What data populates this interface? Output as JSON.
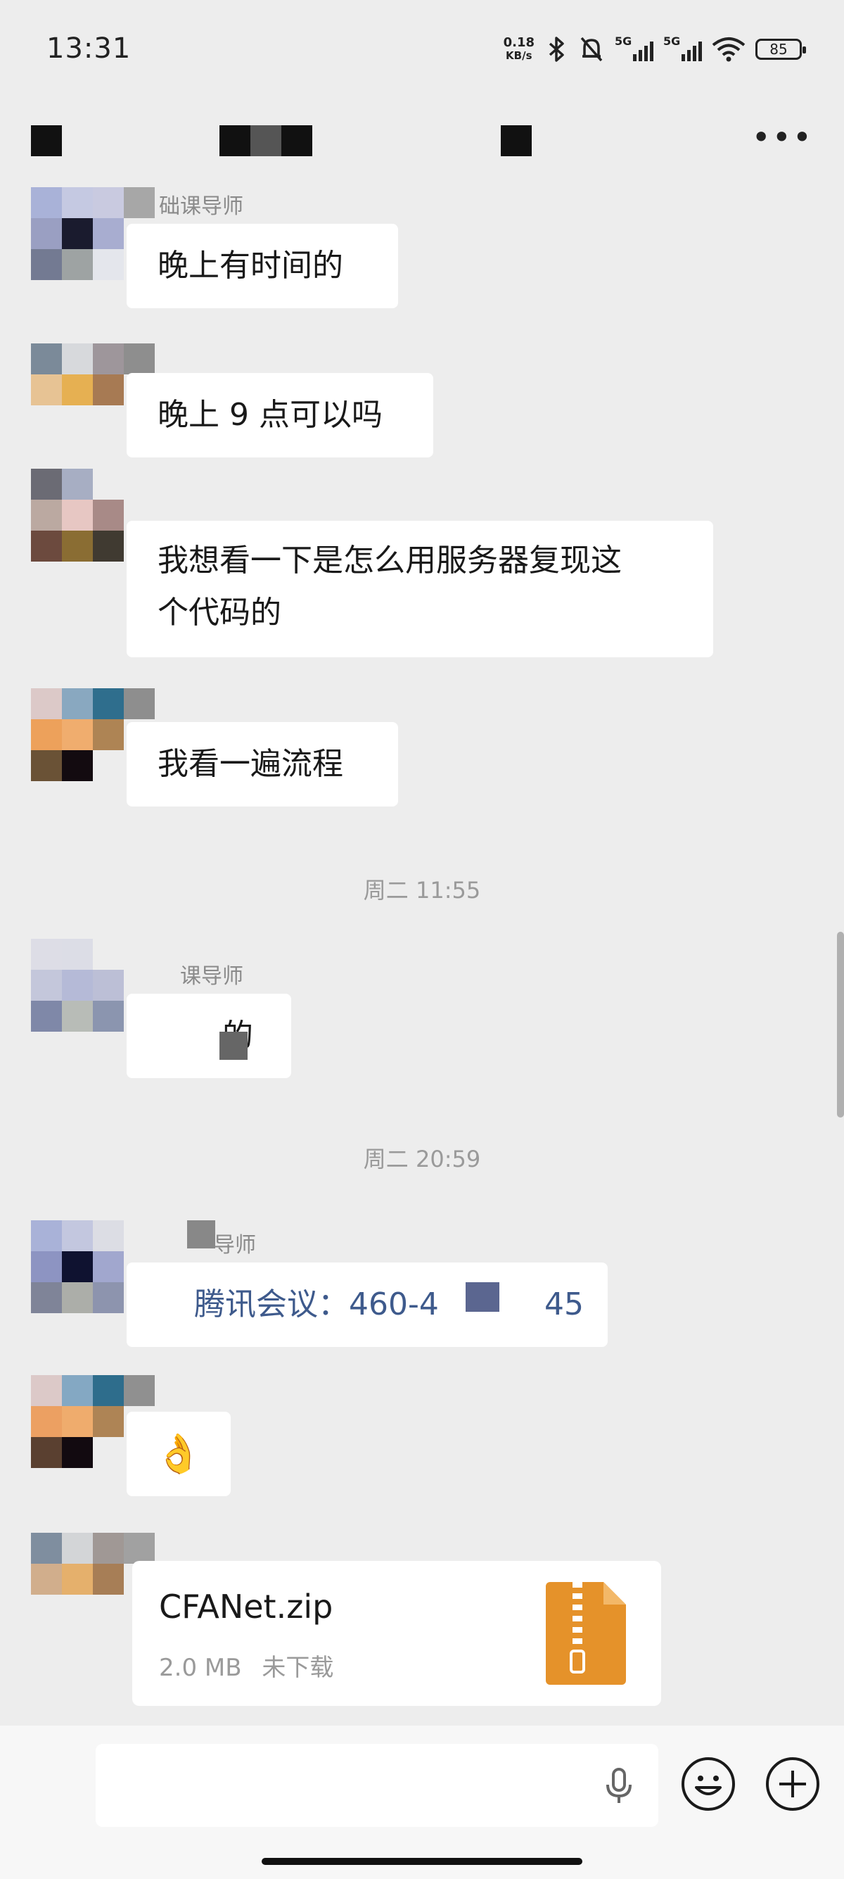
{
  "status_bar": {
    "time": "13:31",
    "speed_value": "0.18",
    "speed_unit": "KB/s",
    "network_1": "5G",
    "network_2": "5G",
    "battery": "85"
  },
  "header": {
    "more_icon": "more-icon"
  },
  "messages": [
    {
      "sender": "础课导师",
      "text": "晚上有时间的"
    },
    {
      "text": "晚上 9 点可以吗"
    },
    {
      "text_line1": "我想看一下是怎么用服务器复现这",
      "text_line2": "个代码的"
    },
    {
      "text": "我看一遍流程"
    },
    {
      "timestamp": "周二 11:55"
    },
    {
      "sender": "课导师",
      "text": "的"
    },
    {
      "timestamp": "周二 20:59"
    },
    {
      "sender": "导师",
      "text_a": "腾讯会议：460-4",
      "text_b": "45"
    },
    {
      "emoji": "👌"
    },
    {
      "file_name": "CFANet.zip",
      "file_size": "2.0 MB",
      "file_status": "未下载"
    }
  ],
  "input_bar": {
    "voice_icon": "microphone-icon",
    "emoji_icon": "smiley-icon",
    "plus_icon": "plus-icon"
  }
}
